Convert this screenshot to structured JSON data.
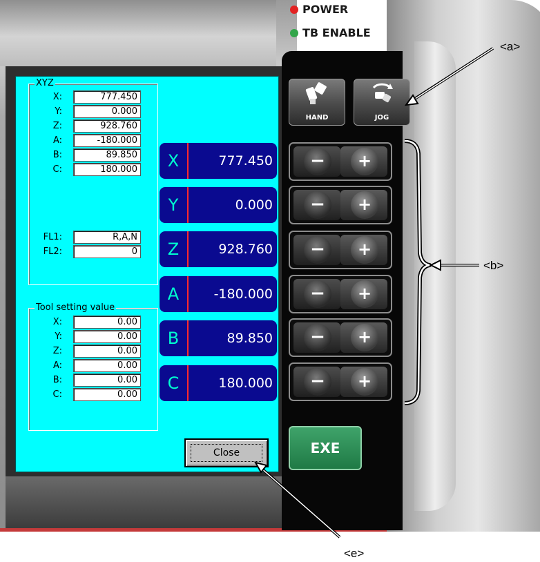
{
  "leds": [
    {
      "label": "POWER",
      "color": "#e22222"
    },
    {
      "label": "TB ENABLE",
      "color": "#33a64a"
    }
  ],
  "mode_buttons": [
    {
      "label": "HAND",
      "icon": "robot-hand-icon"
    },
    {
      "label": "JOG",
      "icon": "jog-rotate-icon"
    }
  ],
  "jog_buttons": {
    "minus": "−",
    "plus": "+"
  },
  "exe_label": "EXE",
  "dialog": {
    "xyz_group": {
      "title": "XYZ",
      "fields": [
        {
          "label": "X:",
          "value": "777.450"
        },
        {
          "label": "Y:",
          "value": "0.000"
        },
        {
          "label": "Z:",
          "value": "928.760"
        },
        {
          "label": "A:",
          "value": "-180.000"
        },
        {
          "label": "B:",
          "value": "89.850"
        },
        {
          "label": "C:",
          "value": "180.000"
        }
      ],
      "flags": [
        {
          "label": "FL1:",
          "value": "R,A,N"
        },
        {
          "label": "FL2:",
          "value": "0"
        }
      ]
    },
    "tool_group": {
      "title": "Tool setting value",
      "fields": [
        {
          "label": "X:",
          "value": "0.00"
        },
        {
          "label": "Y:",
          "value": "0.00"
        },
        {
          "label": "Z:",
          "value": "0.00"
        },
        {
          "label": "A:",
          "value": "0.00"
        },
        {
          "label": "B:",
          "value": "0.00"
        },
        {
          "label": "C:",
          "value": "0.00"
        }
      ]
    },
    "axes": [
      {
        "axis": "X",
        "value": "777.450"
      },
      {
        "axis": "Y",
        "value": "0.000"
      },
      {
        "axis": "Z",
        "value": "928.760"
      },
      {
        "axis": "A",
        "value": "-180.000"
      },
      {
        "axis": "B",
        "value": "89.850"
      },
      {
        "axis": "C",
        "value": "180.000"
      }
    ],
    "close_label": "Close"
  },
  "callouts": {
    "a": "<a>",
    "b": "<b>",
    "e": "<e>"
  },
  "colors": {
    "dialog_bg": "#00ffff",
    "axis_bg": "#0a0a90",
    "axis_letter": "#00ffd0",
    "exe": "#2a9a5a"
  }
}
